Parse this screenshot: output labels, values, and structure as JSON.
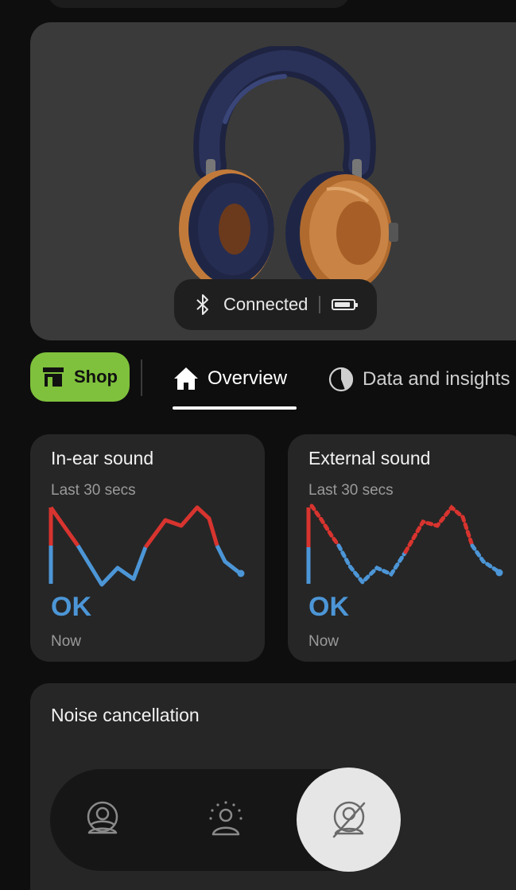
{
  "device": {
    "connection_status": "Connected",
    "battery_level": 0.85
  },
  "tabs": {
    "shop_label": "Shop",
    "overview_label": "Overview",
    "insights_label": "Data and insights",
    "active": "Overview"
  },
  "cards": {
    "in_ear": {
      "title": "In-ear sound",
      "subtitle": "Last 30 secs",
      "status": "OK",
      "time": "Now"
    },
    "external": {
      "title": "External sound",
      "subtitle": "Last 30 secs",
      "status": "OK",
      "time": "Now"
    }
  },
  "noise_cancellation": {
    "title": "Noise cancellation",
    "modes": [
      "off-icon",
      "transparency-icon",
      "anc-icon"
    ],
    "selected": "anc-icon"
  },
  "colors": {
    "shop_green": "#7fc13c",
    "ok_blue": "#4c96d7",
    "alert_red": "#d8342f",
    "card_bg": "#262626"
  }
}
